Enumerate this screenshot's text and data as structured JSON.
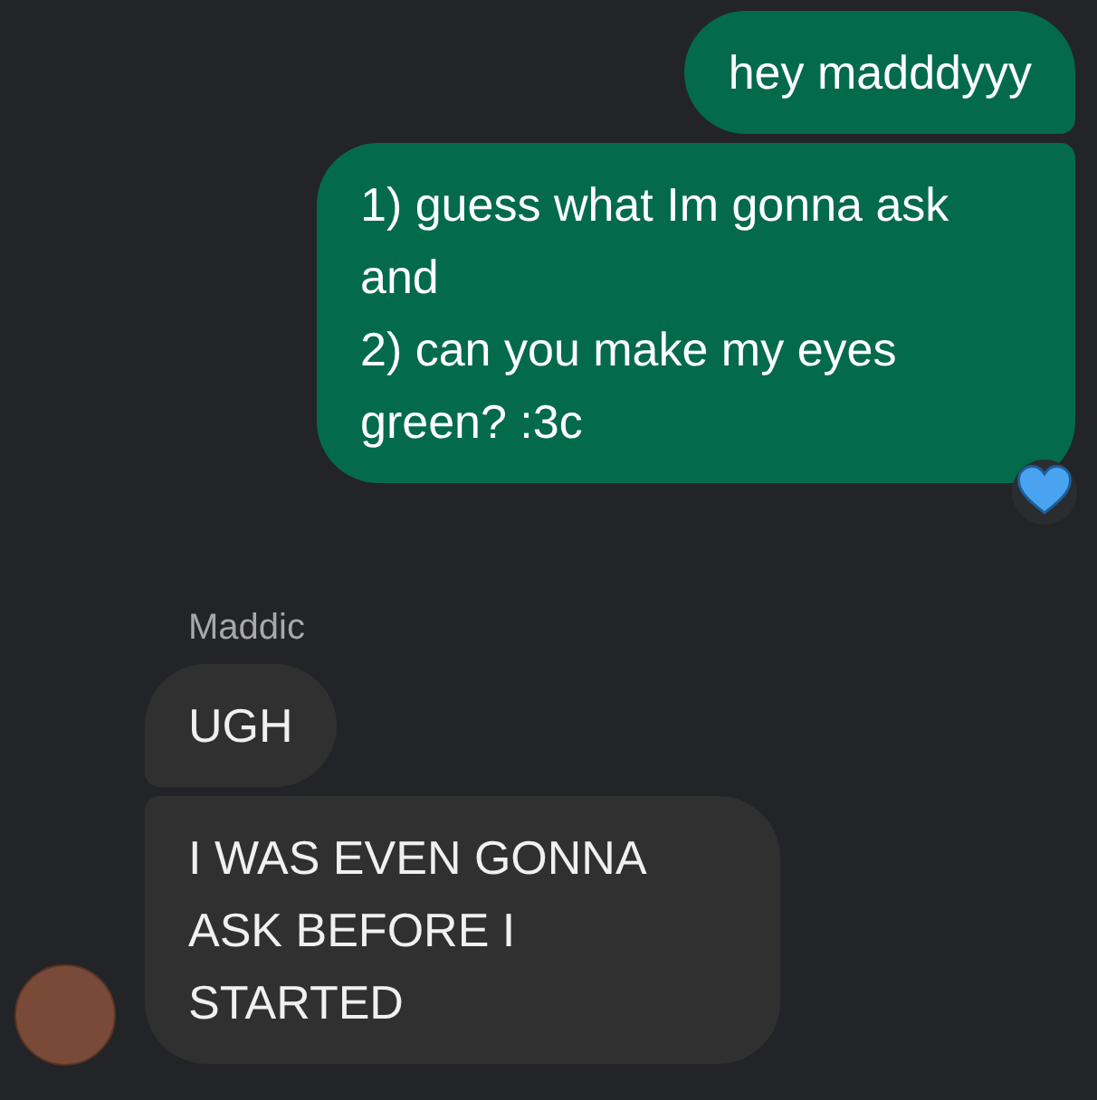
{
  "conversation": [
    {
      "kind": "outgoing",
      "messages": [
        {
          "text": "hey madddyyy"
        },
        {
          "text": "1) guess what Im gonna ask and\n2) can you make my eyes green? :3c",
          "reaction": {
            "kind": "heart"
          }
        }
      ]
    },
    {
      "kind": "incoming",
      "sender": "Maddic",
      "avatar": true,
      "messages": [
        {
          "text": "UGH"
        },
        {
          "text": "I WAS EVEN GONNA ASK BEFORE I STARTED"
        }
      ]
    }
  ]
}
